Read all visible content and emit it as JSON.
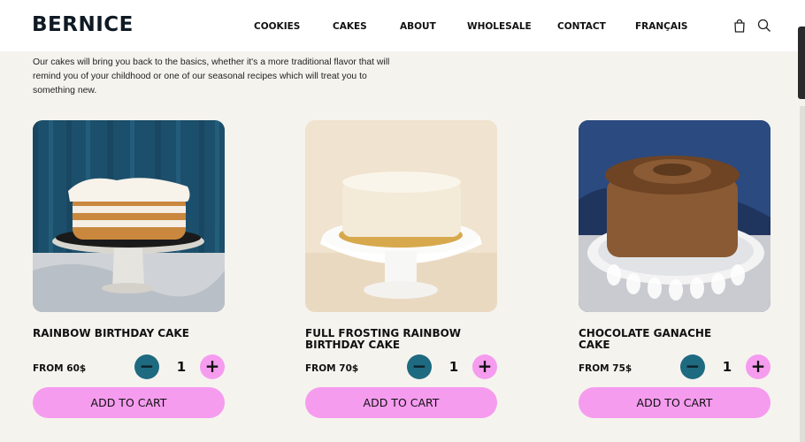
{
  "header": {
    "logo": "BERNICE",
    "nav": [
      "COOKIES",
      "CAKES",
      "ABOUT",
      "WHOLESALE",
      "CONTACT",
      "FRANÇAIS"
    ],
    "icons": [
      "shopping-bag-icon",
      "search-icon"
    ]
  },
  "intro": "Our cakes will bring you back to the basics, whether it's a more traditional flavor that will remind you of your childhood or one of our seasonal recipes which will treat you to something new.",
  "products": [
    {
      "title": "RAINBOW BIRTHDAY CAKE",
      "price": "FROM 60$",
      "quantity": "1",
      "minus": "−",
      "plus": "+",
      "add_to_cart": "ADD TO CART"
    },
    {
      "title": "FULL FROSTING RAINBOW BIRTHDAY CAKE",
      "price": "FROM 70$",
      "quantity": "1",
      "minus": "−",
      "plus": "+",
      "add_to_cart": "ADD TO CART"
    },
    {
      "title": "CHOCOLATE GANACHE CAKE",
      "price": "FROM 75$",
      "quantity": "1",
      "minus": "−",
      "plus": "+",
      "add_to_cart": "ADD TO CART"
    }
  ],
  "colors": {
    "accent_pink": "#f59cef",
    "accent_teal": "#1e6a80",
    "background": "#f5f3ee"
  }
}
